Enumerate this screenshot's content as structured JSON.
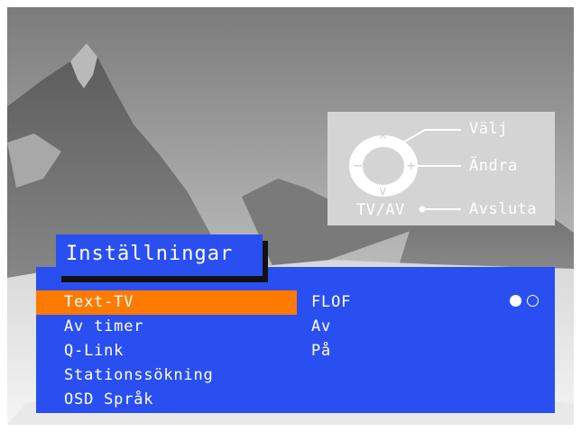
{
  "help": {
    "select_label": "Välj",
    "change_label": "Ändra",
    "exit_label": "Avsluta",
    "exit_key_label": "TV/AV",
    "up_symbol": "^",
    "down_symbol": "v",
    "minus_symbol": "−",
    "plus_symbol": "+"
  },
  "menu": {
    "title": "Inställningar",
    "items": [
      {
        "label": "Text-TV",
        "value": "FLOF",
        "selected": true
      },
      {
        "label": "Av timer",
        "value": "Av",
        "selected": false
      },
      {
        "label": "Q-Link",
        "value": "På",
        "selected": false
      },
      {
        "label": "Stationssökning",
        "value": "",
        "selected": false
      },
      {
        "label": "OSD Språk",
        "value": "",
        "selected": false
      }
    ],
    "page_indicator": {
      "pages": 2,
      "current": 1
    }
  },
  "colors": {
    "menu_background": "#2a4ff0",
    "highlight": "#ff7a00",
    "help_panel": "#d4d4d4",
    "text": "#ffffff"
  },
  "icons": [
    "nav-ring-icon",
    "filled-dot-icon",
    "empty-dot-icon"
  ]
}
